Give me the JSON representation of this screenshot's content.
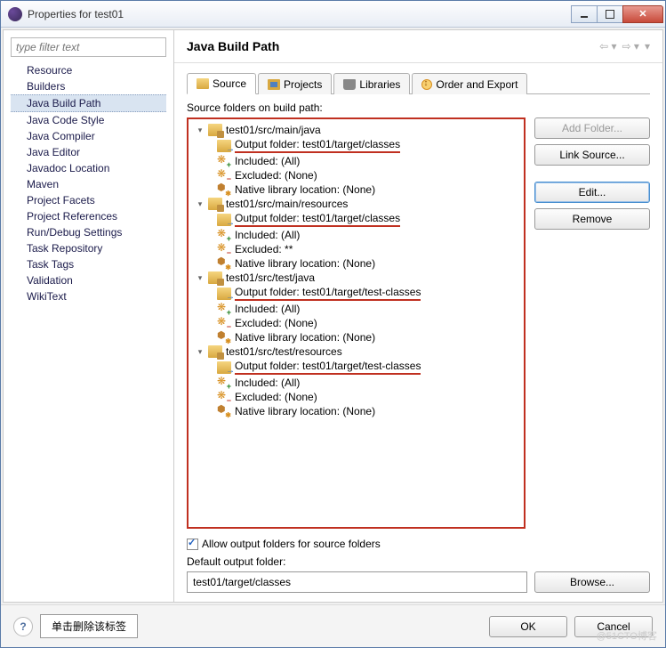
{
  "window": {
    "title": "Properties for test01"
  },
  "sidebar": {
    "filter_placeholder": "type filter text",
    "items": [
      {
        "label": "Resource"
      },
      {
        "label": "Builders"
      },
      {
        "label": "Java Build Path",
        "selected": true
      },
      {
        "label": "Java Code Style"
      },
      {
        "label": "Java Compiler"
      },
      {
        "label": "Java Editor"
      },
      {
        "label": "Javadoc Location"
      },
      {
        "label": "Maven"
      },
      {
        "label": "Project Facets"
      },
      {
        "label": "Project References"
      },
      {
        "label": "Run/Debug Settings"
      },
      {
        "label": "Task Repository"
      },
      {
        "label": "Task Tags"
      },
      {
        "label": "Validation"
      },
      {
        "label": "WikiText"
      }
    ]
  },
  "main": {
    "heading": "Java Build Path",
    "tabs": [
      {
        "label": "Source",
        "icon": "src",
        "active": true
      },
      {
        "label": "Projects",
        "icon": "proj"
      },
      {
        "label": "Libraries",
        "icon": "lib"
      },
      {
        "label": "Order and Export",
        "icon": "ord"
      }
    ],
    "subhead": "Source folders on build path:",
    "side_buttons": {
      "add_folder": "Add Folder...",
      "link_source": "Link Source...",
      "edit": "Edit...",
      "remove": "Remove"
    },
    "tree": [
      {
        "path": "test01/src/main/java",
        "output": "Output folder: test01/target/classes",
        "included": "Included: (All)",
        "excluded": "Excluded: (None)",
        "native": "Native library location: (None)"
      },
      {
        "path": "test01/src/main/resources",
        "output": "Output folder: test01/target/classes",
        "included": "Included: (All)",
        "excluded": "Excluded: **",
        "native": "Native library location: (None)"
      },
      {
        "path": "test01/src/test/java",
        "output": "Output folder: test01/target/test-classes",
        "included": "Included: (All)",
        "excluded": "Excluded: (None)",
        "native": "Native library location: (None)"
      },
      {
        "path": "test01/src/test/resources",
        "output": "Output folder: test01/target/test-classes",
        "included": "Included: (All)",
        "excluded": "Excluded: (None)",
        "native": "Native library location: (None)"
      }
    ],
    "allow_output_label": "Allow output folders for source folders",
    "default_output_label": "Default output folder:",
    "default_output_value": "test01/target/classes",
    "browse": "Browse..."
  },
  "footer": {
    "annotation": "单击删除该标签",
    "ok": "OK",
    "cancel": "Cancel"
  },
  "watermark": "@51CTO博客"
}
